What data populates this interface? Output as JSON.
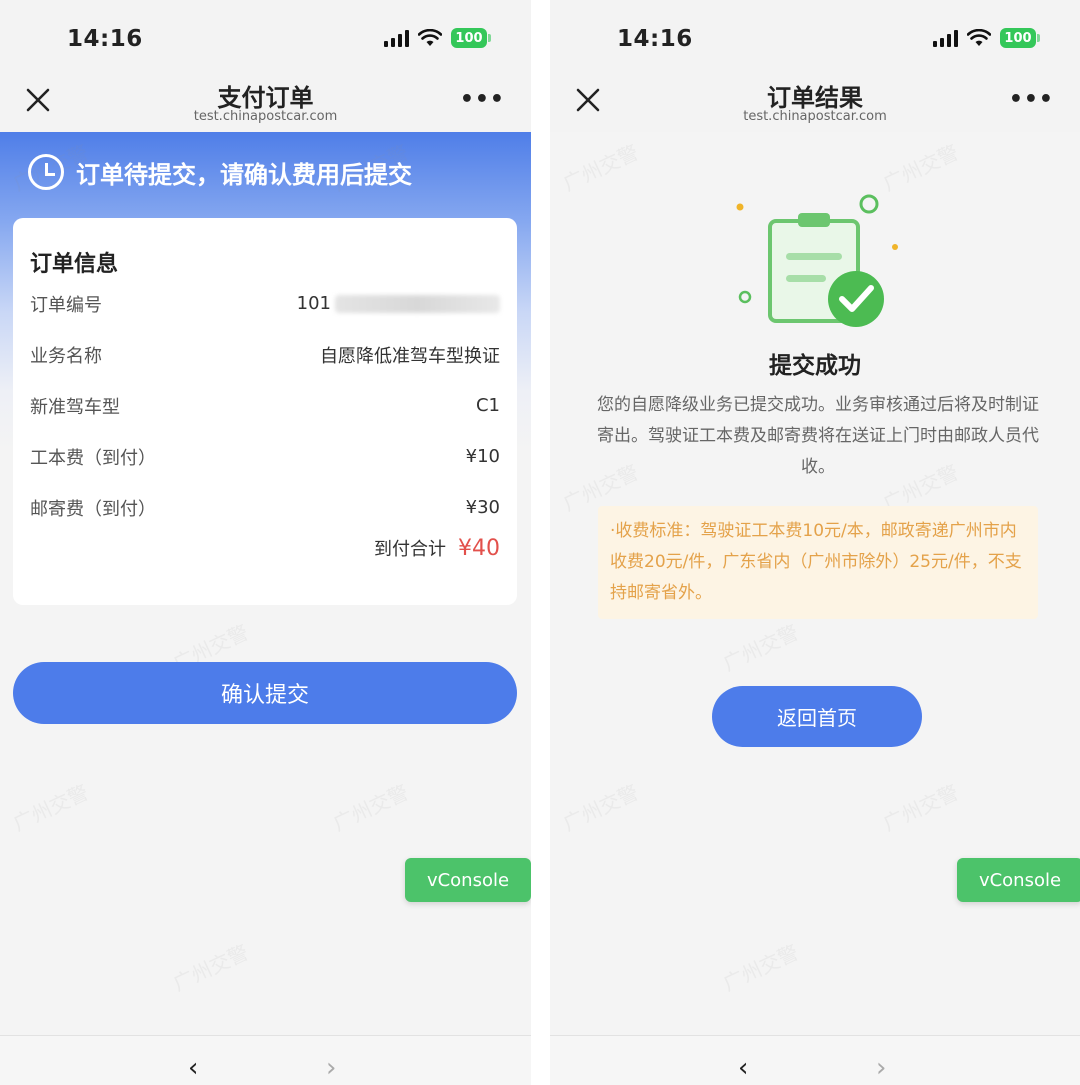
{
  "left_screen": {
    "status_bar": {
      "time": "14:16",
      "battery": "100"
    },
    "nav": {
      "title": "支付订单",
      "host": "test.chinapostcar.com"
    },
    "banner_text": "订单待提交，请确认费用后提交",
    "watermark": "广州交警",
    "order_card": {
      "title": "订单信息",
      "rows": [
        {
          "label": "订单编号",
          "value": "101"
        },
        {
          "label": "业务名称",
          "value": "自愿降低准驾车型换证"
        },
        {
          "label": "新准驾车型",
          "value": "C1"
        },
        {
          "label": "工本费（到付）",
          "value": "¥10"
        },
        {
          "label": "邮寄费（到付）",
          "value": "¥30"
        }
      ],
      "total_label": "到付合计",
      "total_value": "¥40"
    },
    "confirm_button": "确认提交",
    "vconsole": "vConsole"
  },
  "right_screen": {
    "status_bar": {
      "time": "14:16",
      "battery": "100"
    },
    "nav": {
      "title": "订单结果",
      "host": "test.chinapostcar.com"
    },
    "watermark": "广州交警",
    "result_title": "提交成功",
    "result_desc": "您的自愿降级业务已提交成功。业务审核通过后将及时制证寄出。驾驶证工本费及邮寄费将在送证上门时由邮政人员代收。",
    "notice": "·收费标准：驾驶证工本费10元/本，邮政寄递广州市内收费20元/件，广东省内（广州市除外）25元/件，不支持邮寄省外。",
    "home_button": "返回首页",
    "vconsole": "vConsole"
  },
  "colors": {
    "primary": "#4d7cea",
    "price_red": "#e2504b",
    "success_green": "#4cc36a",
    "notice_text": "#e4a24a",
    "notice_bg": "#fdf4e4"
  },
  "icons": [
    "close-icon",
    "more-icon",
    "clock-icon",
    "signal-icon",
    "wifi-icon",
    "battery-icon",
    "back-arrow-icon",
    "forward-arrow-icon",
    "clipboard-success-illustration"
  ]
}
